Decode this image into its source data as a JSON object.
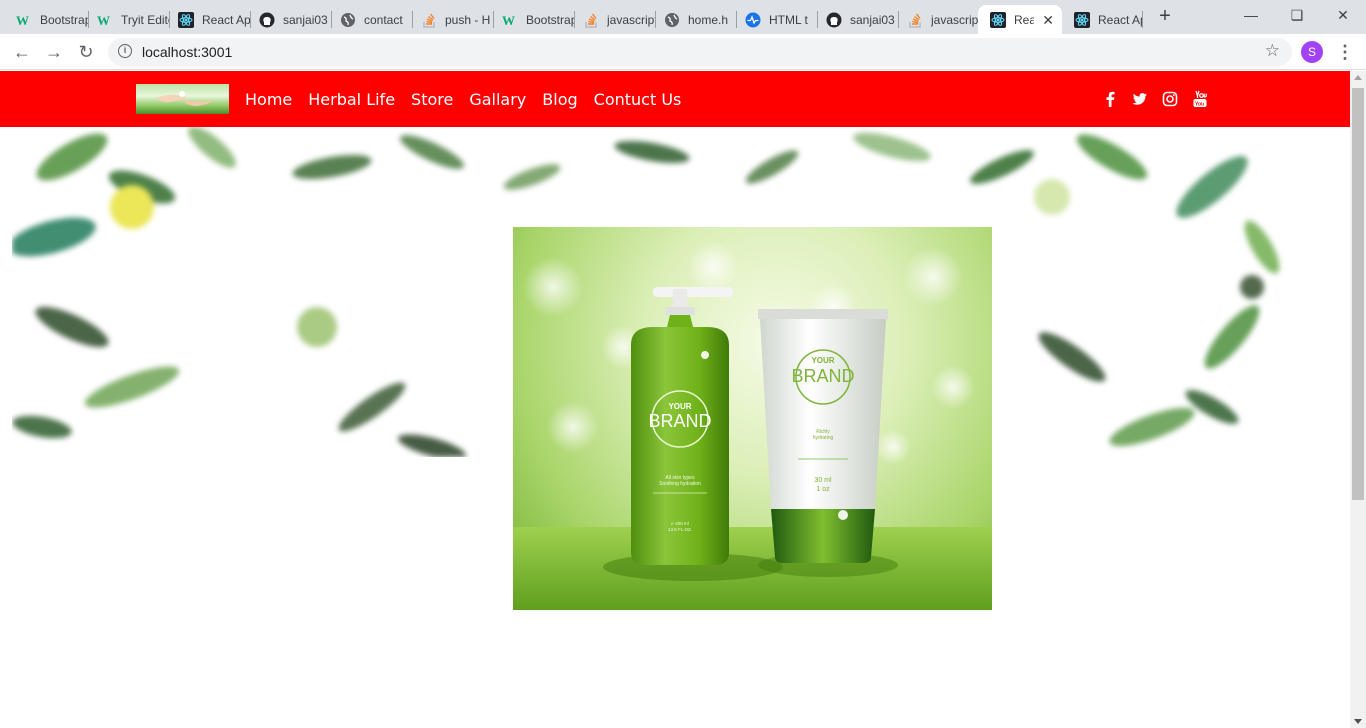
{
  "browser": {
    "tabs": [
      {
        "title": "Bootstrap",
        "icon": "w3schools-icon"
      },
      {
        "title": "Tryit Editor",
        "icon": "w3schools-icon"
      },
      {
        "title": "React App",
        "icon": "react-icon"
      },
      {
        "title": "sanjai03",
        "icon": "github-icon"
      },
      {
        "title": "contact",
        "icon": "globe-icon"
      },
      {
        "title": "push - H",
        "icon": "stackoverflow-icon"
      },
      {
        "title": "Bootstrap",
        "icon": "w3schools-icon"
      },
      {
        "title": "javascript",
        "icon": "stackoverflow-icon"
      },
      {
        "title": "home.h",
        "icon": "globe-icon"
      },
      {
        "title": "HTML t",
        "icon": "pulse-icon"
      },
      {
        "title": "sanjai03",
        "icon": "github-icon"
      },
      {
        "title": "javascript",
        "icon": "stackoverflow-icon"
      },
      {
        "title": "React App",
        "icon": "react-icon",
        "active": true
      },
      {
        "title": "React App",
        "icon": "react-icon"
      }
    ],
    "url": "localhost:3001",
    "profile_initial": "S"
  },
  "site": {
    "nav_links": [
      "Home",
      "Herbal Life",
      "Store",
      "Gallary",
      "Blog",
      "Contuct Us"
    ],
    "social_icons": [
      "facebook-icon",
      "twitter-icon",
      "instagram-icon",
      "youtube-icon"
    ]
  },
  "product_image": {
    "bottle_brand_top": "YOUR",
    "bottle_brand": "BRAND",
    "bottle_text_1": "All skin types",
    "bottle_text_2": "Soothing hydration",
    "bottle_volume_1": "℮ 400 ml",
    "bottle_volume_2": "13.5 FL.OZ.",
    "tube_brand_top": "YOUR",
    "tube_brand": "BRAND",
    "tube_text_1": "Richly",
    "tube_text_2": "hydrating",
    "tube_volume_1": "30 ml",
    "tube_volume_2": "1 oz"
  },
  "colors": {
    "nav_bg": "#ff0000",
    "nav_text": "#ffffff",
    "bottle_green": "#6fb118",
    "tube_cap": "#2f7a17"
  }
}
